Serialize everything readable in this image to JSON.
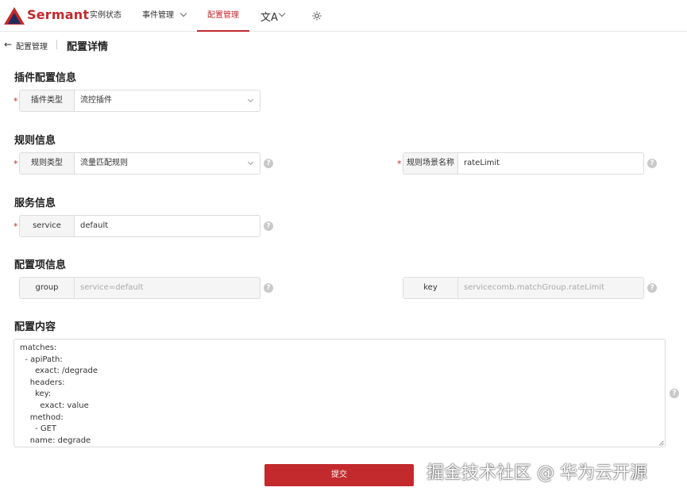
{
  "app": {
    "brand": "Sermant"
  },
  "nav": {
    "items": [
      {
        "label": "实例状态"
      },
      {
        "label": "事件管理"
      },
      {
        "label": "配置管理"
      }
    ],
    "lang_icon": "文A",
    "theme_icon": "sun-icon"
  },
  "breadcrumb": {
    "parent": "配置管理",
    "title": "配置详情"
  },
  "sections": {
    "plugin": "插件配置信息",
    "rule": "规则信息",
    "service": "服务信息",
    "config_item": "配置项信息",
    "content": "配置内容"
  },
  "fields": {
    "plugin_type": {
      "label": "插件类型",
      "value": "流控插件"
    },
    "rule_type": {
      "label": "规则类型",
      "value": "流量匹配规则"
    },
    "rule_scene": {
      "label": "规则场景名称",
      "value": "rateLimit"
    },
    "service": {
      "label": "service",
      "value": "default"
    },
    "group": {
      "label": "group",
      "value": "service=default"
    },
    "key": {
      "label": "key",
      "value": "servicecomb.matchGroup.rateLimit"
    }
  },
  "config_content": "matches:\n  - apiPath:\n      exact: /degrade\n    headers:\n      key:\n        exact: value\n    method:\n      - GET\n    name: degrade",
  "submit_label": "提交",
  "watermark": "掘金技术社区 @ 华为云开源",
  "colors": {
    "accent": "#c32a2d"
  }
}
